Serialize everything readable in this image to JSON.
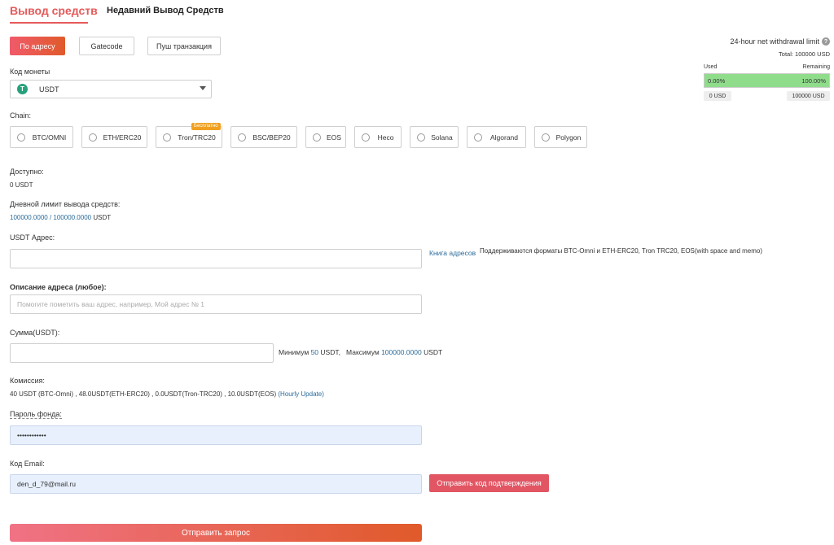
{
  "tabs": {
    "active": "Вывод средств",
    "second": "Недавний Вывод Средств"
  },
  "methods": {
    "address": "По адресу",
    "gatecode": "Gatecode",
    "push": "Пуш транзакция"
  },
  "coin": {
    "label": "Код монеты",
    "icon": "T",
    "value": "USDT"
  },
  "chain": {
    "label": "Chain:",
    "free_badge": "Бесплатно",
    "options": [
      "BTC/OMNI",
      "ETH/ERC20",
      "Tron/TRC20",
      "BSC/BEP20",
      "EOS",
      "Heco",
      "Solana",
      "Algorand",
      "Polygon"
    ]
  },
  "available": {
    "label": "Доступно:",
    "value": "0 USDT"
  },
  "daily": {
    "label": "Дневной лимит вывода средств:",
    "used": "100000.0000",
    "sep": " / ",
    "total": "100000.0000",
    "unit": " USDT"
  },
  "address": {
    "label": "USDT Адрес:",
    "book": "Книга адресов",
    "formats": "Поддерживаются форматы BTC-Omni и ETH-ERC20, Tron TRC20, EOS(with space and memo)"
  },
  "memo": {
    "label": "Описание адреса (любое):",
    "placeholder": "Помогите пометить ваш адрес, например, Мой адрес № 1"
  },
  "amount": {
    "label": "Сумма(USDT):",
    "min_prefix": "Минимум ",
    "min": "50",
    "min_suffix": " USDT,   Максимум ",
    "max": "100000.0000",
    "max_suffix": " USDT"
  },
  "fee": {
    "label": "Комиссия:",
    "text": "40 USDT (BTC-Omni) , 48.0USDT(ETH-ERC20) , 0.0USDT(Tron-TRC20) , 10.0USDT(EOS) ",
    "update": "(Hourly Update)"
  },
  "fund_password": {
    "label": "Пароль фонда:",
    "value": "••••••••••••"
  },
  "email": {
    "label": "Код Email:",
    "value": "den_d_79@mail.ru",
    "send": "Отправить код подтверждения"
  },
  "submit": "Отправить запрос",
  "limit": {
    "title": "24-hour net withdrawal limit",
    "help": "?",
    "total": "Total: 100000 USD",
    "used_label": "Used",
    "remaining_label": "Remaining",
    "used_pct": "0.00%",
    "remaining_pct": "100.00%",
    "used_value": "0 USD",
    "remaining_value": "100000 USD",
    "fill_fraction": 1.0
  }
}
